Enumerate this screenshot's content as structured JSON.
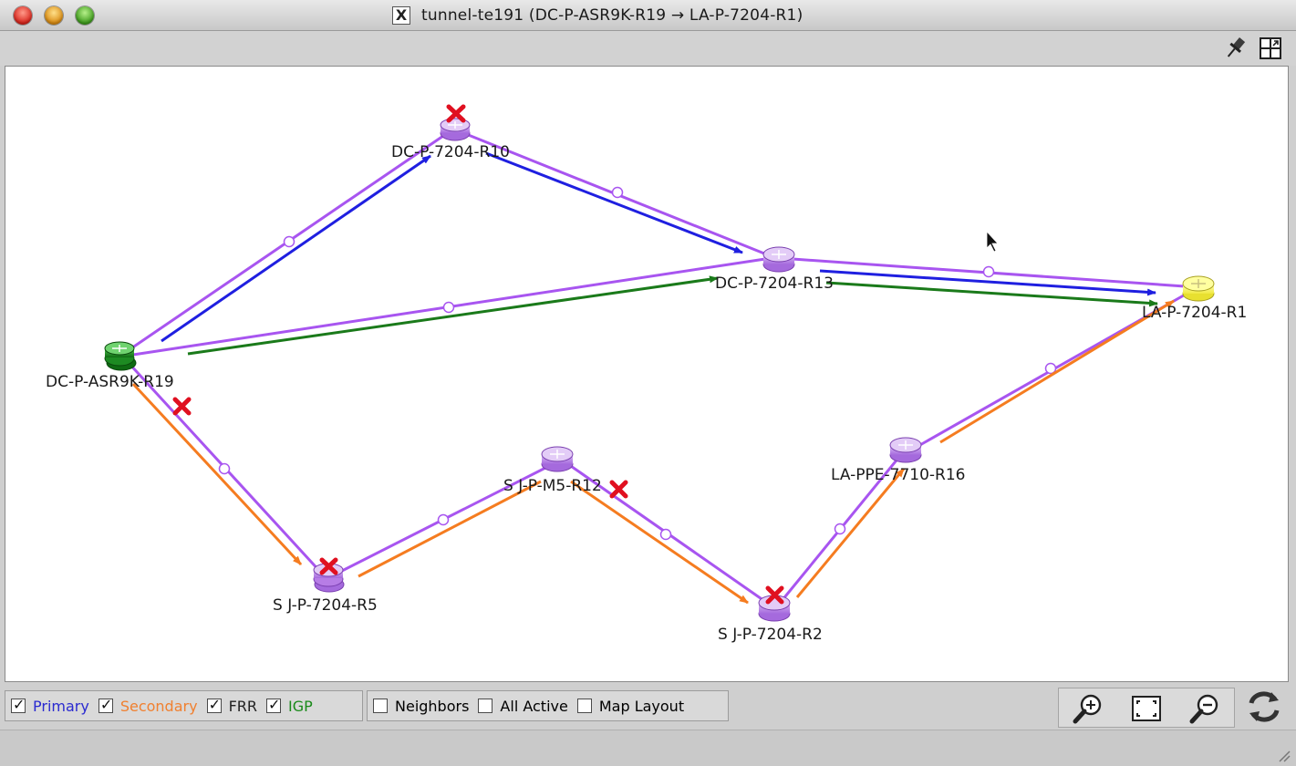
{
  "window": {
    "title": "tunnel-te191 (DC-P-ASR9K-R19 → LA-P-7204-R1)",
    "title_icon": "x11-icon"
  },
  "toolbar": {
    "pin_icon": "pin-icon",
    "layout_icon": "window-layout-icon"
  },
  "graph": {
    "nodes": [
      {
        "id": "r10",
        "label": "DC-P-7204-R10",
        "color": "#b77de6",
        "failed": true
      },
      {
        "id": "r13",
        "label": "DC-P-7204-R13",
        "color": "#b77de6",
        "failed": false
      },
      {
        "id": "r19",
        "label": "DC-P-ASR9K-R19",
        "color": "#1d8a22",
        "role": "head-end"
      },
      {
        "id": "r1",
        "label": "LA-P-7204-R1",
        "color": "#ffff66",
        "role": "tail-end"
      },
      {
        "id": "r5",
        "label": "S J-P-7204-R5",
        "color": "#b77de6",
        "failed": true
      },
      {
        "id": "r12",
        "label": "S J-P-M5-R12",
        "color": "#b77de6",
        "failed": false
      },
      {
        "id": "r2",
        "label": "S J-P-7204-R2",
        "color": "#b77de6",
        "failed": true
      },
      {
        "id": "r16",
        "label": "LA-PPE-7710-R16",
        "color": "#b77de6",
        "failed": false
      }
    ],
    "links_color": "#a855f0",
    "paths": {
      "primary": {
        "color": "#1f1fe0",
        "hops": [
          "DC-P-ASR9K-R19",
          "DC-P-7204-R10",
          "DC-P-7204-R13",
          "LA-P-7204-R1"
        ]
      },
      "secondary": {
        "color": "#f57c20",
        "hops": [
          "DC-P-ASR9K-R19",
          "S J-P-7204-R5",
          "S J-P-M5-R12",
          "S J-P-7204-R2",
          "LA-PPE-7710-R16",
          "LA-P-7204-R1"
        ]
      },
      "igp": {
        "color": "#1a7a1a",
        "hops": [
          "DC-P-ASR9K-R19",
          "DC-P-7204-R13",
          "LA-P-7204-R1"
        ]
      }
    },
    "failure_color": "#e01020"
  },
  "filters": {
    "primary": {
      "label": "Primary",
      "checked": true,
      "color": "#2a2ad0"
    },
    "secondary": {
      "label": "Secondary",
      "checked": true,
      "color": "#f08030"
    },
    "frr": {
      "label": "FRR",
      "checked": true,
      "color": "#222222"
    },
    "igp": {
      "label": "IGP",
      "checked": true,
      "color": "#1a8a1a"
    },
    "neighbors": {
      "label": "Neighbors",
      "checked": false
    },
    "all_active": {
      "label": "All Active",
      "checked": false
    },
    "map_layout": {
      "label": "Map Layout",
      "checked": false
    }
  },
  "zoom": {
    "zoom_in_icon": "zoom-in-icon",
    "fit_icon": "fit-to-window-icon",
    "zoom_out_icon": "zoom-out-icon"
  },
  "refresh": {
    "icon": "refresh-icon"
  }
}
